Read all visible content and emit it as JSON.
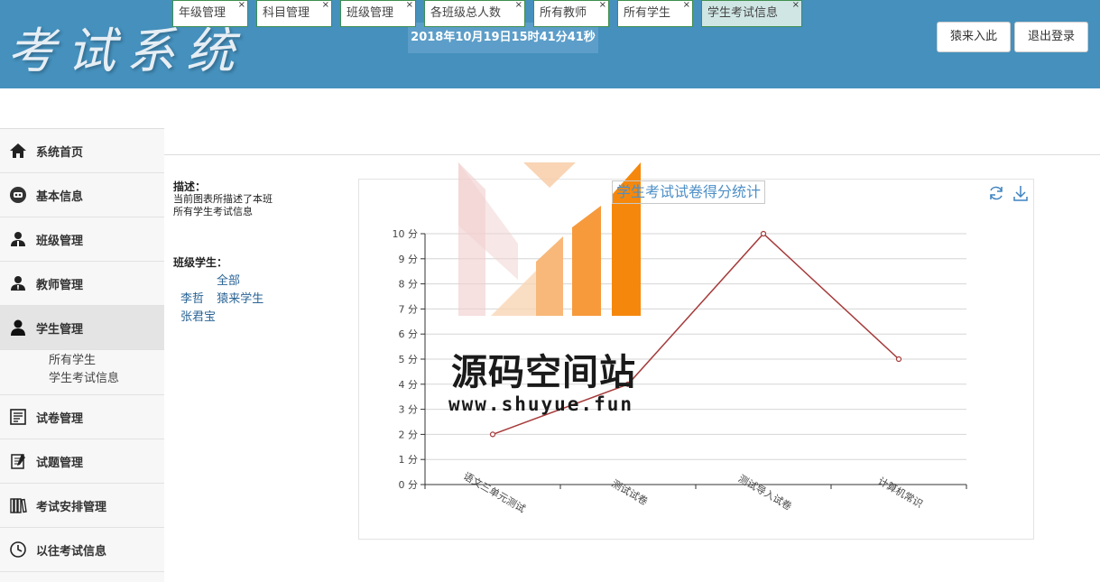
{
  "header": {
    "logo": "考试系统",
    "datetime": "2018年10月19日15时41分41秒",
    "buttons": {
      "user": "猿来入此",
      "logout": "退出登录"
    }
  },
  "sidebar": {
    "items": [
      {
        "label": "系统首页",
        "icon": "home-icon"
      },
      {
        "label": "基本信息",
        "icon": "info-icon"
      },
      {
        "label": "班级管理",
        "icon": "user-icon"
      },
      {
        "label": "教师管理",
        "icon": "teacher-icon"
      },
      {
        "label": "学生管理",
        "icon": "student-icon"
      },
      {
        "label": "试卷管理",
        "icon": "paper-icon"
      },
      {
        "label": "试题管理",
        "icon": "question-icon"
      },
      {
        "label": "考试安排管理",
        "icon": "books-icon"
      },
      {
        "label": "以往考试信息",
        "icon": "clock-icon"
      }
    ],
    "sub_items": [
      "所有学生",
      "学生考试信息"
    ]
  },
  "tabs": [
    "年级管理",
    "科目管理",
    "班级管理",
    "各班级总人数",
    "所有教师",
    "所有学生",
    "学生考试信息"
  ],
  "tab_close": "×",
  "description": {
    "label": "描述：",
    "text": "当前图表所描述了本班 所有学生考试信息"
  },
  "students": {
    "label": "班级学生：",
    "all": "全部",
    "names": [
      "李哲",
      "猿来学生",
      "张君宝"
    ]
  },
  "watermark": {
    "cn": "源码空间站",
    "en": "www.shuyue.fun"
  },
  "chart_data": {
    "type": "line",
    "title": "学生考试试卷得分统计",
    "categories": [
      "语文三单元测试",
      "测试试卷",
      "测试导入试卷",
      "计算机常识"
    ],
    "values": [
      2,
      4,
      10,
      5
    ],
    "ylim": [
      0,
      10
    ],
    "y_ticks": [
      "0 分",
      "1 分",
      "2 分",
      "3 分",
      "4 分",
      "5 分",
      "6 分",
      "7 分",
      "8 分",
      "9 分",
      "10 分"
    ],
    "grid": true,
    "line_color": "#a63a3a"
  }
}
